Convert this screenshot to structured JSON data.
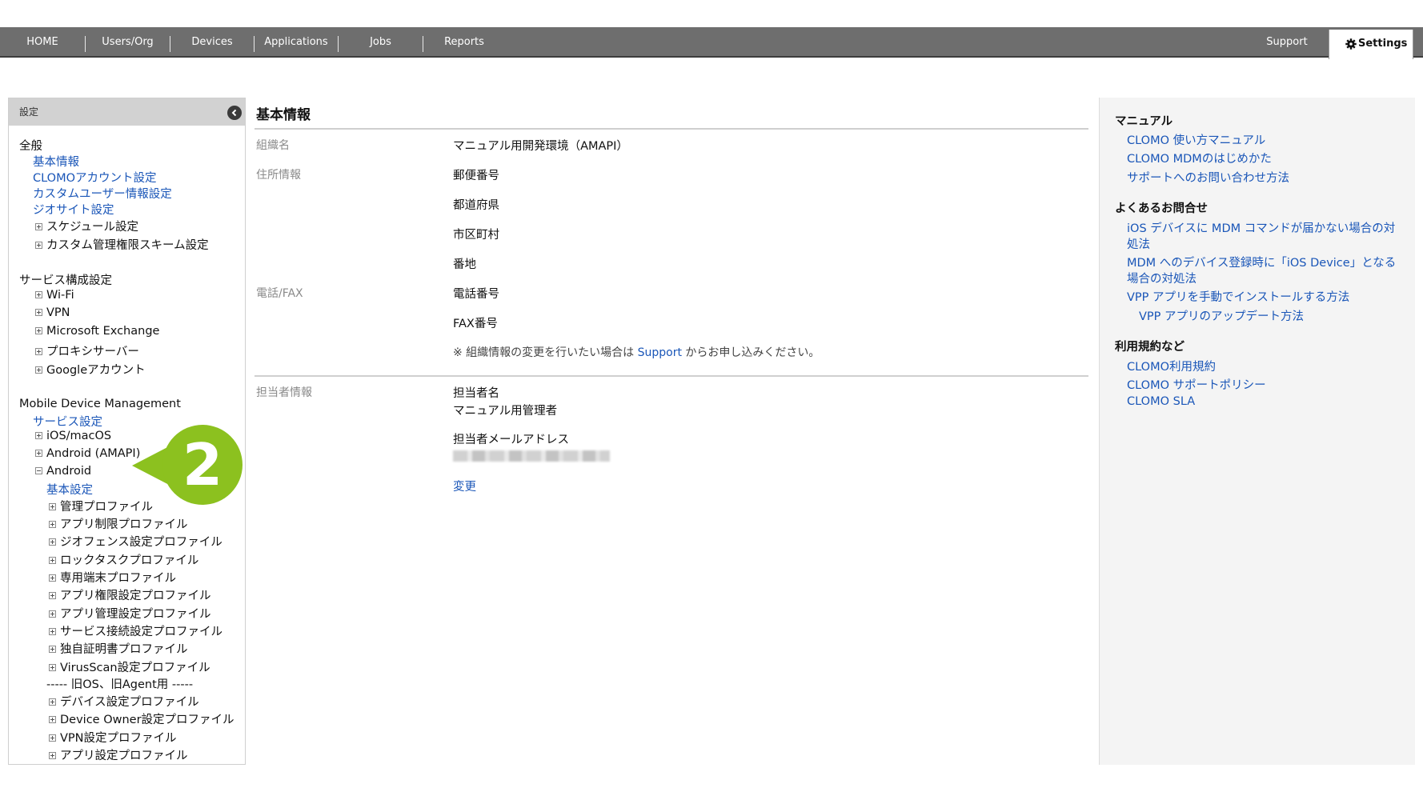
{
  "nav": {
    "items": [
      "HOME",
      "Users/Org",
      "Devices",
      "Applications",
      "Jobs",
      "Reports"
    ],
    "support": "Support",
    "settings": "Settings"
  },
  "sidebar": {
    "header": "設定",
    "general_heading": "全般",
    "general_links": [
      "基本情報",
      "CLOMOアカウント設定",
      "カスタムユーザー情報設定",
      "ジオサイト設定"
    ],
    "general_trees": [
      "スケジュール設定",
      "カスタム管理権限スキーム設定"
    ],
    "service_heading": "サービス構成設定",
    "service_trees": [
      "Wi-Fi",
      "VPN",
      "Microsoft Exchange",
      "プロキシサーバー",
      "Googleアカウント"
    ],
    "mdm_heading": "Mobile Device Management",
    "mdm_service_link": "サービス設定",
    "mdm_trees": [
      "iOS/macOS",
      "Android (AMAPI)"
    ],
    "android_label": "Android",
    "android_basic_link": "基本設定",
    "android_profiles": [
      "管理プロファイル",
      "アプリ制限プロファイル",
      "ジオフェンス設定プロファイル",
      "ロックタスクプロファイル",
      "専用端末プロファイル",
      "アプリ権限設定プロファイル",
      "アプリ管理設定プロファイル",
      "サービス接続設定プロファイル",
      "独自証明書プロファイル",
      "VirusScan設定プロファイル"
    ],
    "legacy_divider": "----- 旧OS、旧Agent用 -----",
    "legacy_profiles": [
      "デバイス設定プロファイル",
      "Device Owner設定プロファイル",
      "VPN設定プロファイル",
      "アプリ設定プロファイル"
    ],
    "callout_number": "2"
  },
  "main": {
    "title": "基本情報",
    "org_label": "組織名",
    "org_value": "マニュアル用開発環境（AMAPI）",
    "address_label": "住所情報",
    "address_fields": [
      "郵便番号",
      "都道府県",
      "市区町村",
      "番地"
    ],
    "phone_label": "電話/FAX",
    "phone_fields": [
      "電話番号",
      "FAX番号"
    ],
    "note_prefix": "※ 組織情報の変更を行いたい場合は ",
    "note_link": "Support",
    "note_suffix": " からお申し込みください。",
    "contact_label": "担当者情報",
    "contact_name_label": "担当者名",
    "contact_name_value": "マニュアル用管理者",
    "contact_email_label": "担当者メールアドレス",
    "change_link": "変更"
  },
  "right": {
    "manual_heading": "マニュアル",
    "manual_links": [
      "CLOMO 使い方マニュアル",
      "CLOMO MDMのはじめかた",
      "サポートへのお問い合わせ方法"
    ],
    "faq_heading": "よくあるお問合せ",
    "faq_links": [
      "iOS デバイスに MDM コマンドが届かない場合の対",
      "処法",
      "MDM へのデバイス登録時に「iOS Device」となる",
      "場合の対処法",
      "VPP アプリを手動でインストールする方法",
      "VPP アプリのアップデート方法"
    ],
    "terms_heading": "利用規約など",
    "terms_links": [
      "CLOMO利用規約",
      "CLOMO サポートポリシー",
      "CLOMO SLA"
    ]
  }
}
